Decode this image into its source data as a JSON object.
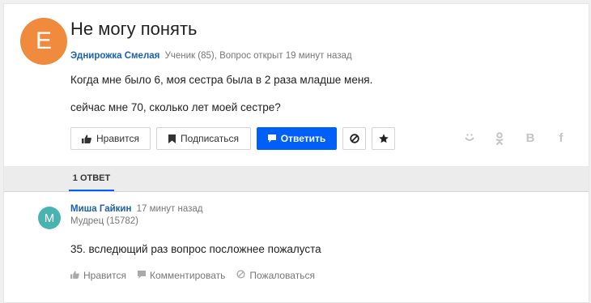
{
  "question": {
    "avatar_letter": "Е",
    "title": "Не могу понять",
    "author": "Эднирожка Смелая",
    "author_rank": "Ученик (85),",
    "opened": "Вопрос открыт 19 минут назад",
    "body": [
      "Когда мне было 6, моя сестра была в 2 раза младше меня.",
      "сейчас мне 70, сколько лет моей сестре?"
    ],
    "buttons": {
      "like": "Нравится",
      "subscribe": "Подписаться",
      "answer": "Ответить"
    },
    "share": {
      "ok": "ок",
      "vk": "В",
      "fb": "f"
    }
  },
  "answers_tab": "1 ОТВЕТ",
  "answer": {
    "avatar_letter": "М",
    "author": "Миша Гайкин",
    "time": "17 минут назад",
    "rank": "Мудрец (15782)",
    "text": "35. вследющий раз вопрос посложнее пожалуста",
    "actions": {
      "like": "Нравится",
      "comment": "Комментировать",
      "report": "Пожаловаться"
    }
  },
  "colors": {
    "accent": "#005ff9",
    "link": "#1a5fb4",
    "q_avatar": "#f08a3c",
    "a_avatar": "#48b3b0"
  }
}
